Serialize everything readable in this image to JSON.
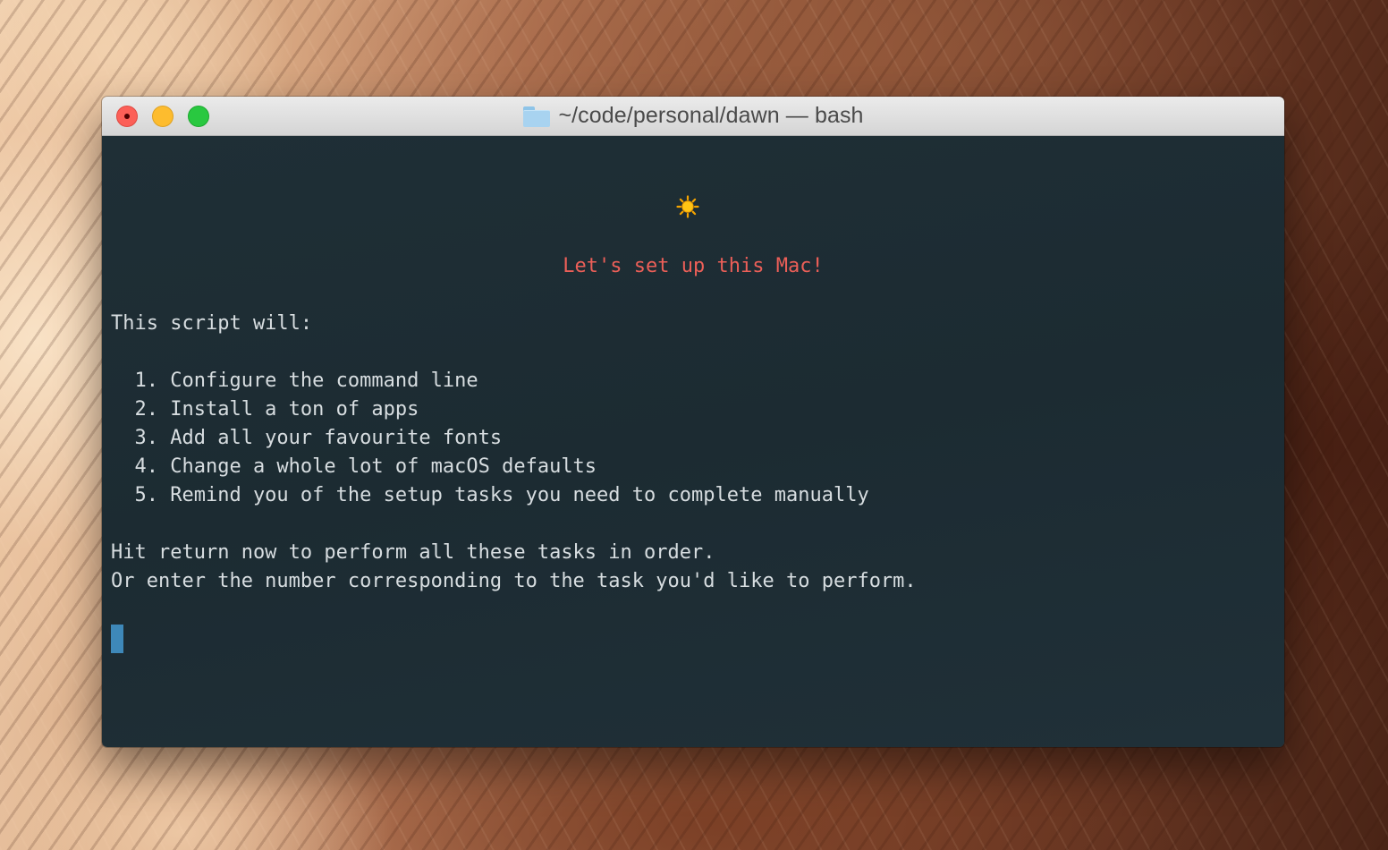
{
  "window": {
    "title": "~/code/personal/dawn — bash"
  },
  "icons": {
    "title_icon": "folder-icon",
    "banner_icon": "sun-icon"
  },
  "colors": {
    "terminal_bg": "#1f2f36",
    "heading": "#ec5f58",
    "text": "#d7dde0",
    "cursor": "#3e88b9"
  },
  "terminal": {
    "heading": "Let's set up this Mac!",
    "intro": "This script will:",
    "tasks": [
      "  1. Configure the command line",
      "  2. Install a ton of apps",
      "  3. Add all your favourite fonts",
      "  4. Change a whole lot of macOS defaults",
      "  5. Remind you of the setup tasks you need to complete manually"
    ],
    "prompt_line_1": "Hit return now to perform all these tasks in order.",
    "prompt_line_2": "Or enter the number corresponding to the task you'd like to perform."
  }
}
